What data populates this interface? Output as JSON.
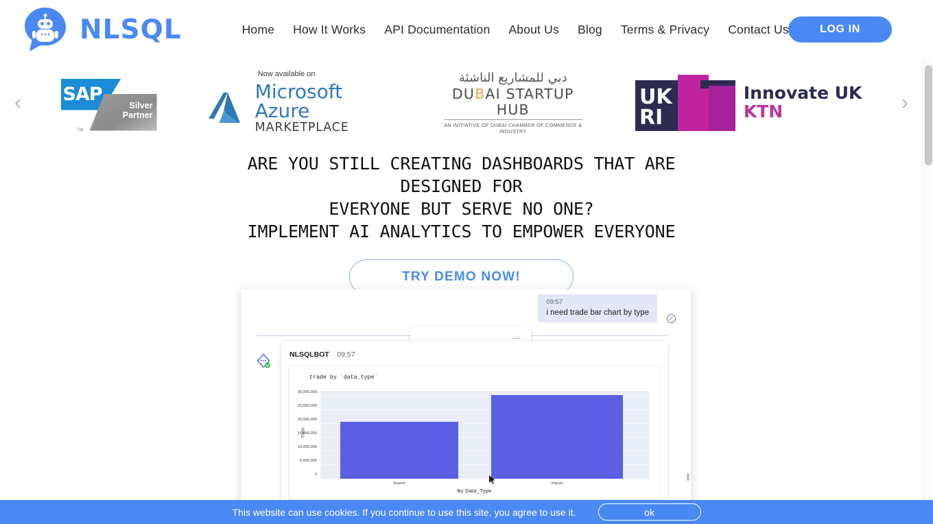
{
  "brand": {
    "name": "NLSQL",
    "logo_icon": "robot-chat-bubble-icon",
    "accent": "#4a89f3"
  },
  "nav": {
    "items": [
      {
        "label": "Home"
      },
      {
        "label": "How It Works"
      },
      {
        "label": "API Documentation"
      },
      {
        "label": "About Us"
      },
      {
        "label": "Blog"
      },
      {
        "label": "Terms & Privacy"
      },
      {
        "label": "Contact Us"
      }
    ],
    "login_label": "LOG IN"
  },
  "carousel": {
    "prev_icon": "chevron-left-icon",
    "next_icon": "chevron-right-icon",
    "logos": [
      {
        "name": "sap-silver-partner",
        "title": "SAP",
        "line1": "Silver",
        "line2": "Partner",
        "tm": "TM",
        "colors": {
          "blue": "#1a8cd8",
          "gray": "#8c8c8c"
        }
      },
      {
        "name": "microsoft-azure-marketplace",
        "eyebrow": "Now available on",
        "title": "Microsoft Azure",
        "subtitle": "MARKETPLACE",
        "colors": {
          "blue": "#2e78b8"
        }
      },
      {
        "name": "dubai-startup-hub",
        "arabic": "دبي للمشاريع الناشئة",
        "title_left": "DU",
        "title_mid": "B",
        "title_right": "AI STARTUP HUB",
        "subtitle": "AN INITIATIVE OF DUBAI CHAMBER OF COMMERCE & INDUSTRY",
        "colors": {
          "accent": "#e8a33d"
        }
      },
      {
        "name": "innovate-uk-ktn",
        "mark_text": "UKRI",
        "title": "Innovate UK",
        "subtitle": "KTN",
        "colors": {
          "navy": "#2d2b52",
          "magenta": "#b6399c"
        }
      }
    ]
  },
  "hero": {
    "headline_line1": "ARE YOU STILL CREATING DASHBOARDS THAT ARE DESIGNED FOR",
    "headline_line2": "EVERYONE BUT SERVE NO ONE?",
    "headline_line3": "IMPLEMENT AI ANALYTICS TO EMPOWER EVERYONE",
    "cta_label": "TRY DEMO NOW!"
  },
  "chat": {
    "user_message": {
      "time": "09:57",
      "text": "i need trade bar chart by type",
      "status_icon": "check-circle-icon"
    },
    "divider_menu_icon": "ellipsis-icon",
    "bot": {
      "avatar_icon": "code-diamond-icon",
      "avatar_badge_icon": "verified-check-icon",
      "name": "NLSQLBOT",
      "time": "09:57"
    },
    "cursor_icon": "mouse-pointer-icon",
    "scrollbar_icon": "scrollbar-thumb"
  },
  "chart_data": {
    "type": "bar",
    "title": "trade by `data_type`",
    "categories": [
      "Export",
      "Import"
    ],
    "values": [
      20800000,
      30500000
    ],
    "xlabel": "By Data_Type",
    "ylabel": "Trade",
    "ylim": [
      0,
      32000000
    ],
    "ytick_labels": [
      "30,000,000",
      "25,000,000",
      "20,000,000",
      "15,000,000",
      "10,000,000",
      "5,000,000",
      "0"
    ],
    "ytick_values": [
      30000000,
      25000000,
      20000000,
      15000000,
      10000000,
      5000000,
      0
    ],
    "grid": true,
    "legend": "none",
    "bar_color": "#5b5fe3",
    "plot_background": "#e9edf6"
  },
  "cookie": {
    "text": "This website can use cookies. If you continue to use this site, you agree to use it.",
    "ok_label": "ok",
    "background": "#4a89f3"
  },
  "page_scrollbar": {
    "icon": "vertical-scrollbar"
  }
}
